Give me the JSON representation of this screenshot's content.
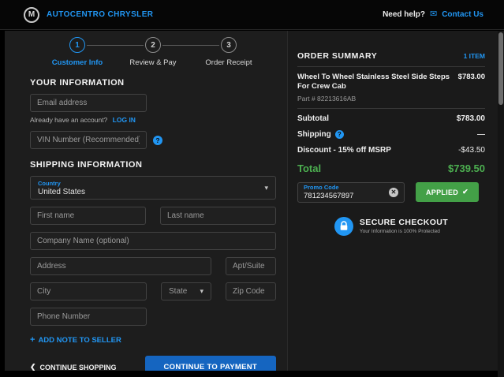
{
  "header": {
    "brand": "AUTOCENTRO CHRYSLER",
    "need_help": "Need help?",
    "contact_us": "Contact Us"
  },
  "stepper": {
    "steps": [
      {
        "number": "1",
        "label": "Customer Info"
      },
      {
        "number": "2",
        "label": "Review & Pay"
      },
      {
        "number": "3",
        "label": "Order Receipt"
      }
    ]
  },
  "your_information": {
    "title": "YOUR INFORMATION",
    "email_placeholder": "Email address",
    "account_text": "Already have an account?",
    "login_link": "LOG IN",
    "vin_placeholder": "VIN Number (Recommended)"
  },
  "shipping_form": {
    "title": "SHIPPING INFORMATION",
    "country_label": "Country",
    "country_value": "United States",
    "first_name_placeholder": "First name",
    "last_name_placeholder": "Last name",
    "company_placeholder": "Company Name (optional)",
    "address_placeholder": "Address",
    "apt_placeholder": "Apt/Suite",
    "city_placeholder": "City",
    "state_placeholder": "State",
    "zip_placeholder": "Zip Code",
    "phone_placeholder": "Phone Number",
    "add_note_label": "ADD NOTE TO SELLER"
  },
  "footer": {
    "continue_shopping": "CONTINUE SHOPPING",
    "continue_to_payment": "CONTINUE TO PAYMENT"
  },
  "summary": {
    "title": "ORDER SUMMARY",
    "item_count": "1 ITEM",
    "product": {
      "name": "Wheel To Wheel Stainless Steel Side Steps For Crew Cab",
      "price": "$783.00",
      "part": "Part # 82213616AB"
    },
    "subtotal_label": "Subtotal",
    "subtotal_value": "$783.00",
    "shipping_label": "Shipping",
    "shipping_value": "—",
    "discount_label": "Discount - 15% off MSRP",
    "discount_value": "-$43.50",
    "total_label": "Total",
    "total_value": "$739.50",
    "promo_label": "Promo Code",
    "promo_value": "781234567897",
    "applied_label": "APPLIED",
    "secure_title": "SECURE CHECKOUT",
    "secure_subtitle": "Your Information is 100% Protected"
  },
  "icons": {
    "logo_letter": "M",
    "mail": "✉",
    "help": "?",
    "dropdown": "▾",
    "plus": "+",
    "chevron_left": "❮",
    "check": "✔",
    "clear": "✕"
  },
  "colors": {
    "accent_blue": "#2196f3",
    "success_green": "#4caf50",
    "button_blue": "#1565c0"
  }
}
